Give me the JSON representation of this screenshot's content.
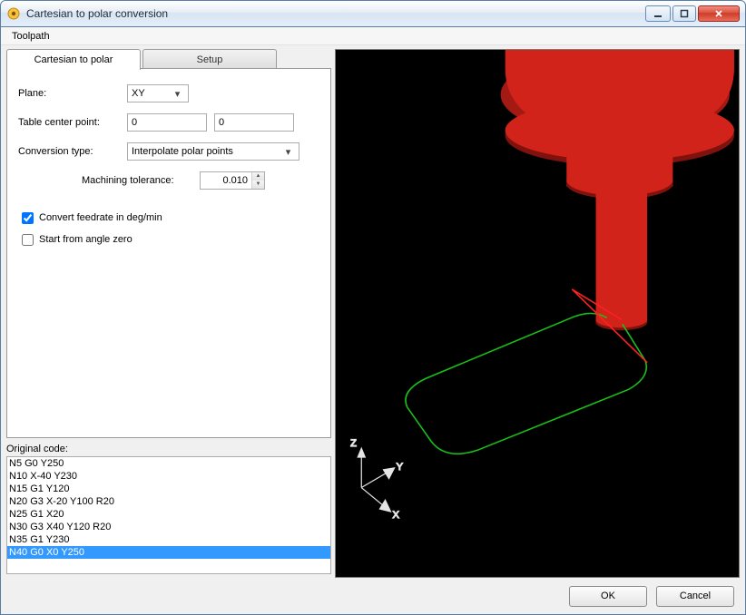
{
  "window": {
    "title": "Cartesian to polar conversion"
  },
  "menu": {
    "toolpath": "Toolpath"
  },
  "tabs": {
    "cartesian": "Cartesian to polar",
    "setup": "Setup"
  },
  "form": {
    "plane_label": "Plane:",
    "plane_value": "XY",
    "center_label": "Table center point:",
    "center_x": "0",
    "center_y": "0",
    "conv_label": "Conversion type:",
    "conv_value": "Interpolate polar points",
    "tol_label": "Machining tolerance:",
    "tol_value": "0.010",
    "cb_feedrate": "Convert feedrate in deg/min",
    "cb_anglezero": "Start from angle zero"
  },
  "original_code": {
    "label": "Original code:",
    "lines": [
      "N5 G0 Y250",
      "N10 X-40 Y230",
      "N15 G1 Y120",
      "N20 G3 X-20 Y100 R20",
      "N25 G1 X20",
      "N30 G3 X40 Y120 R20",
      "N35 G1 Y230",
      "N40 G0 X0 Y250"
    ],
    "selected_index": 7
  },
  "buttons": {
    "ok": "OK",
    "cancel": "Cancel"
  },
  "axes": {
    "x": "X",
    "y": "Y",
    "z": "Z"
  },
  "colors": {
    "viewport_bg": "#000000",
    "tool_red": "#d2231b",
    "tool_red_dark": "#a31913",
    "path_green": "#18c018",
    "path_rapid_red": "#ff2020",
    "selection": "#3399ff"
  }
}
